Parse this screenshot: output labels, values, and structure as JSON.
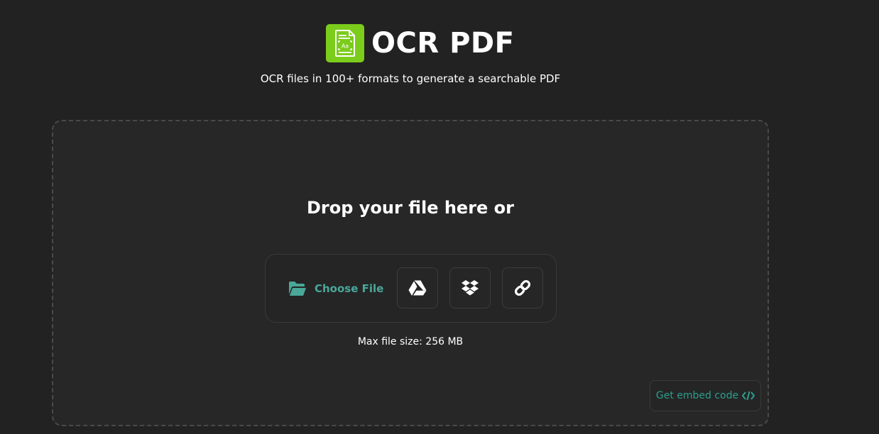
{
  "header": {
    "title": "OCR PDF",
    "subtitle": "OCR files in 100+ formats to generate a searchable PDF",
    "logo_color": "#7ccc1c"
  },
  "dropzone": {
    "heading": "Drop your file here or",
    "choose_file_label": "Choose File",
    "sources": [
      {
        "name": "google-drive",
        "icon": "google-drive-icon"
      },
      {
        "name": "dropbox",
        "icon": "dropbox-icon"
      },
      {
        "name": "url",
        "icon": "link-icon"
      }
    ],
    "max_size": "Max file size: 256 MB",
    "embed_label": "Get embed code"
  },
  "colors": {
    "accent": "#49a89a",
    "embed_accent": "#2b9e8e",
    "background": "#222222"
  }
}
